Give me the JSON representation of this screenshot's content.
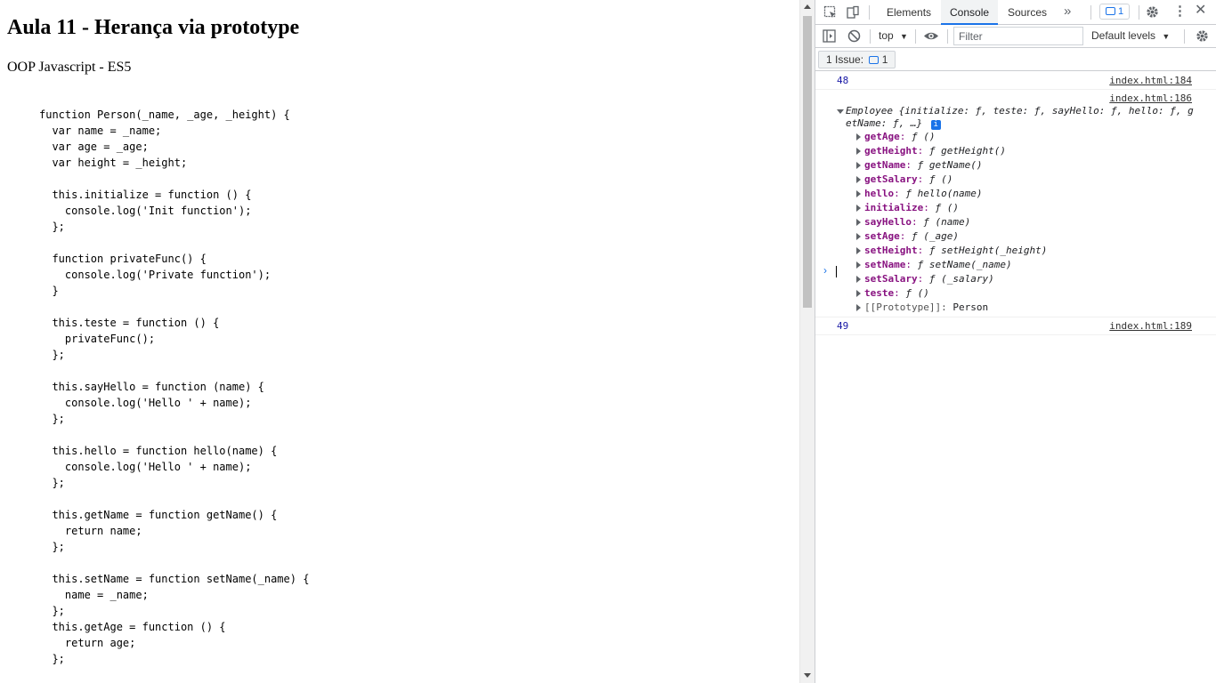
{
  "page": {
    "title": "Aula 11 - Herança via prototype",
    "subtitle": "OOP Javascript - ES5",
    "code_lines": [
      "function Person(_name, _age, _height) {",
      "  var name = _name;",
      "  var age = _age;",
      "  var height = _height;",
      "",
      "  this.initialize = function () {",
      "    console.log('Init function');",
      "  };",
      "",
      "  function privateFunc() {",
      "    console.log('Private function');",
      "  }",
      "",
      "  this.teste = function () {",
      "    privateFunc();",
      "  };",
      "",
      "  this.sayHello = function (name) {",
      "    console.log('Hello ' + name);",
      "  };",
      "",
      "  this.hello = function hello(name) {",
      "    console.log('Hello ' + name);",
      "  };",
      "",
      "  this.getName = function getName() {",
      "    return name;",
      "  };",
      "",
      "  this.setName = function setName(_name) {",
      "    name = _name;",
      "  };",
      "  this.getAge = function () {",
      "    return age;",
      "  };"
    ]
  },
  "devtools": {
    "tabs": [
      {
        "label": "Elements",
        "active": false
      },
      {
        "label": "Console",
        "active": true
      },
      {
        "label": "Sources",
        "active": false
      }
    ],
    "issues_badge_count": "1",
    "context": "top",
    "filter_placeholder": "Filter",
    "levels_label": "Default levels",
    "issues_button_label": "1 Issue:",
    "issues_button_count": "1",
    "messages": {
      "first_value": "48",
      "first_link": "index.html:184",
      "object_link": "index.html:186",
      "object_summary_line1": "Employee {initialize: ƒ, teste: ƒ, sayHello: ƒ, hello: ƒ, g",
      "object_summary_line2": "etName: ƒ, …}",
      "info_badge": "i",
      "properties": [
        {
          "key": "getAge",
          "value": "ƒ ()"
        },
        {
          "key": "getHeight",
          "value": "ƒ getHeight()"
        },
        {
          "key": "getName",
          "value": "ƒ getName()"
        },
        {
          "key": "getSalary",
          "value": "ƒ ()"
        },
        {
          "key": "hello",
          "value": "ƒ hello(name)"
        },
        {
          "key": "initialize",
          "value": "ƒ ()"
        },
        {
          "key": "sayHello",
          "value": "ƒ (name)"
        },
        {
          "key": "setAge",
          "value": "ƒ (_age)"
        },
        {
          "key": "setHeight",
          "value": "ƒ setHeight(_height)"
        },
        {
          "key": "setName",
          "value": "ƒ setName(_name)"
        },
        {
          "key": "setSalary",
          "value": "ƒ (_salary)"
        },
        {
          "key": "teste",
          "value": "ƒ ()"
        }
      ],
      "prototype_key": "[[Prototype]]",
      "prototype_value": "Person",
      "last_value": "49",
      "last_link": "index.html:189"
    },
    "prompt_symbol": "›"
  }
}
